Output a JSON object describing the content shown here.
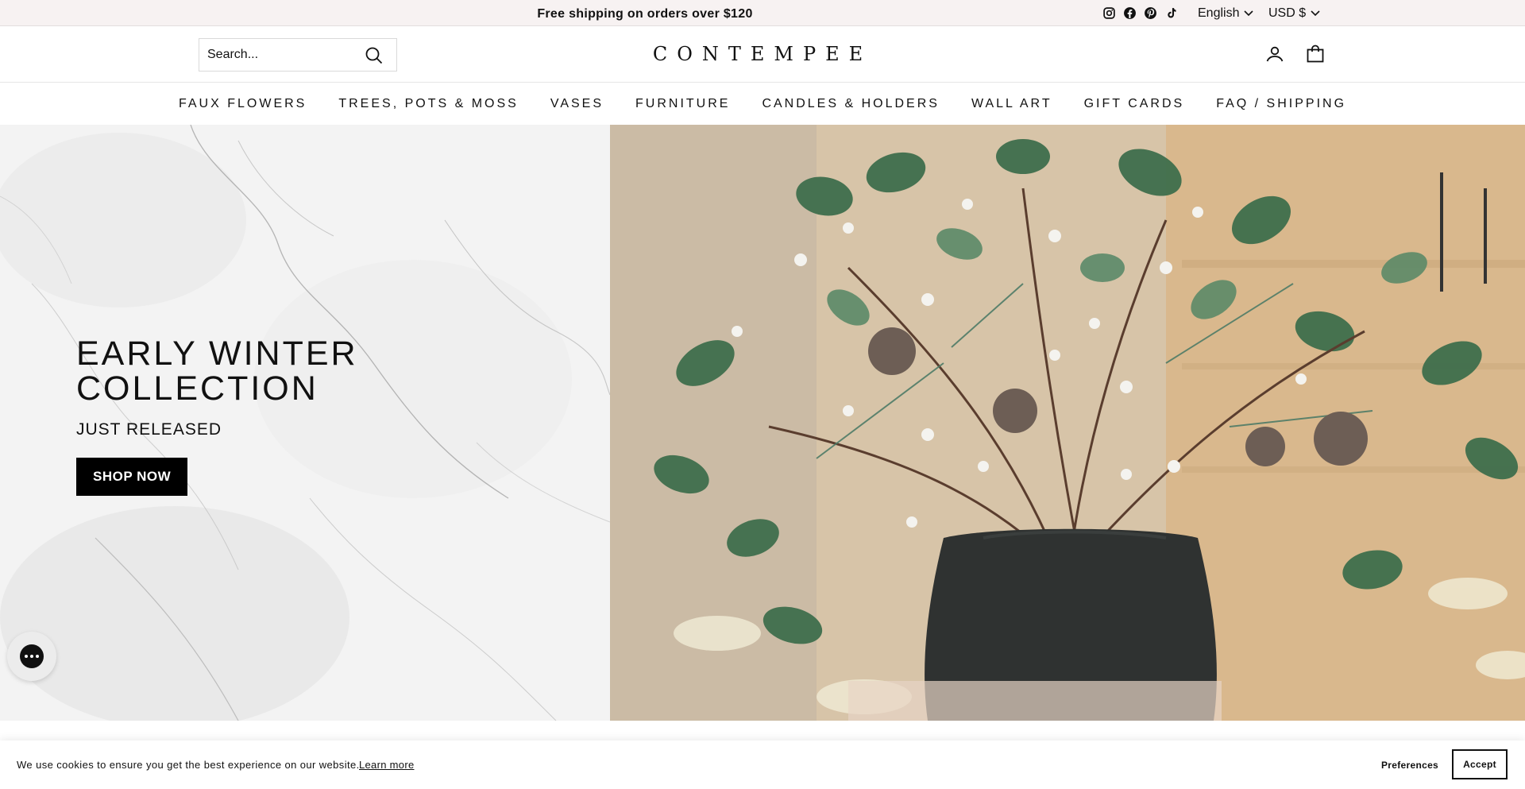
{
  "announcement": {
    "text": "Free shipping on orders over $120",
    "social_icons": [
      "instagram-icon",
      "facebook-icon",
      "pinterest-icon",
      "tiktok-icon"
    ],
    "language": "English",
    "currency": "USD $"
  },
  "header": {
    "search_placeholder": "Search...",
    "logo": "CONTEMPEE",
    "icons": [
      "search-icon",
      "account-icon",
      "cart-icon"
    ]
  },
  "nav": {
    "items": [
      {
        "label": "FAUX FLOWERS"
      },
      {
        "label": "TREES, POTS & MOSS"
      },
      {
        "label": "VASES"
      },
      {
        "label": "FURNITURE"
      },
      {
        "label": "CANDLES & HOLDERS"
      },
      {
        "label": "WALL ART"
      },
      {
        "label": "GIFT CARDS"
      },
      {
        "label": "FAQ / SHIPPING"
      }
    ]
  },
  "hero": {
    "title_line1": "EARLY WINTER",
    "title_line2": "COLLECTION",
    "subtitle": "JUST RELEASED",
    "button": "SHOP NOW"
  },
  "chat": {
    "icon": "chat-icon"
  },
  "cookie": {
    "message": "We use cookies to ensure you get the best experience on our website.",
    "learn_more": "Learn more",
    "preferences": "Preferences",
    "accept": "Accept"
  },
  "colors": {
    "announcement_bg": "#f7f2f2",
    "button_bg": "#000000",
    "marble_bg": "#f2f2f2",
    "photo_wall": "#d4b893",
    "vase": "#2f3231"
  }
}
